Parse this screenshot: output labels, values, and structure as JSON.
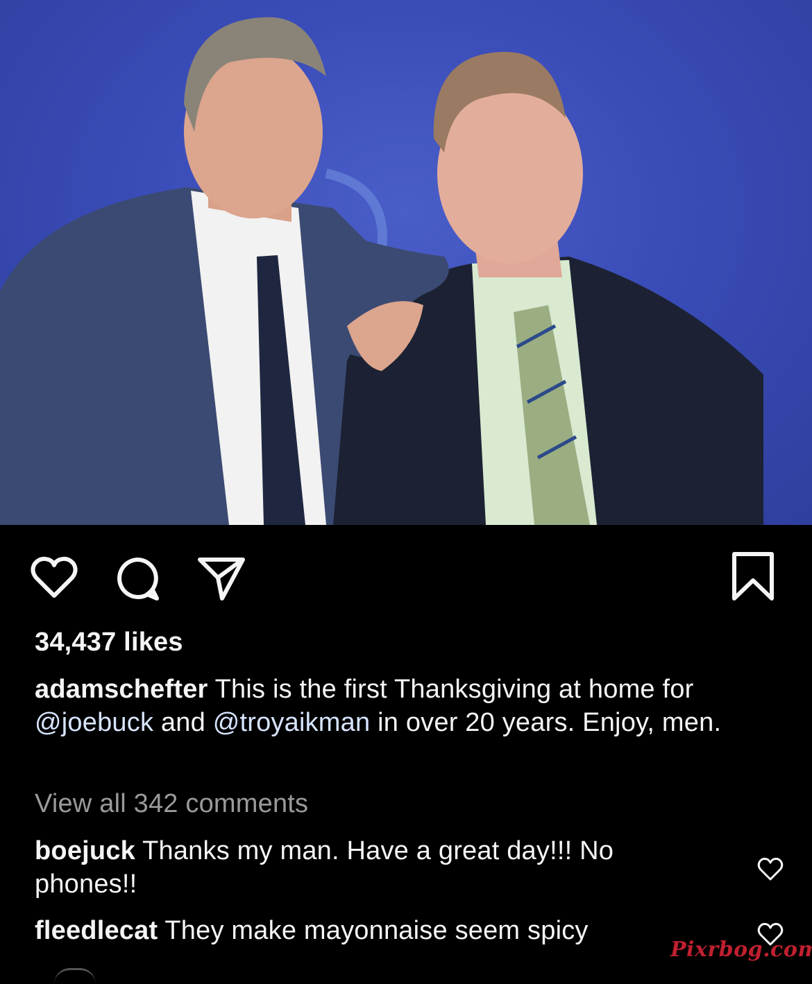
{
  "post": {
    "likes_text": "34,437 likes",
    "caption": {
      "username": "adamschefter",
      "text_1": "This is the first Thanksgiving at home for",
      "mention_1": "@joebuck",
      "text_2": "and",
      "mention_2": "@troyaikman",
      "text_3": "in over 20 years. Enjoy, men."
    },
    "view_all_comments": "View all 342 comments",
    "comments": [
      {
        "username": "boejuck",
        "text": "Thanks my man. Have a great day!!! No phones!!"
      },
      {
        "username": "fleedlecat",
        "text": "They make mayonnaise seem spicy"
      }
    ]
  },
  "icons": {
    "like": "heart-outline-icon",
    "comment": "speech-bubble-icon",
    "share": "paper-plane-icon",
    "save": "bookmark-icon",
    "comment_like": "small-heart-icon"
  },
  "watermark": "Pixrbog.com",
  "colors": {
    "background": "#000000",
    "text": "#f5f5f5",
    "muted": "#9a9a9a",
    "mention": "#d7e4ff",
    "photo_backdrop": "#3a4cb8"
  }
}
